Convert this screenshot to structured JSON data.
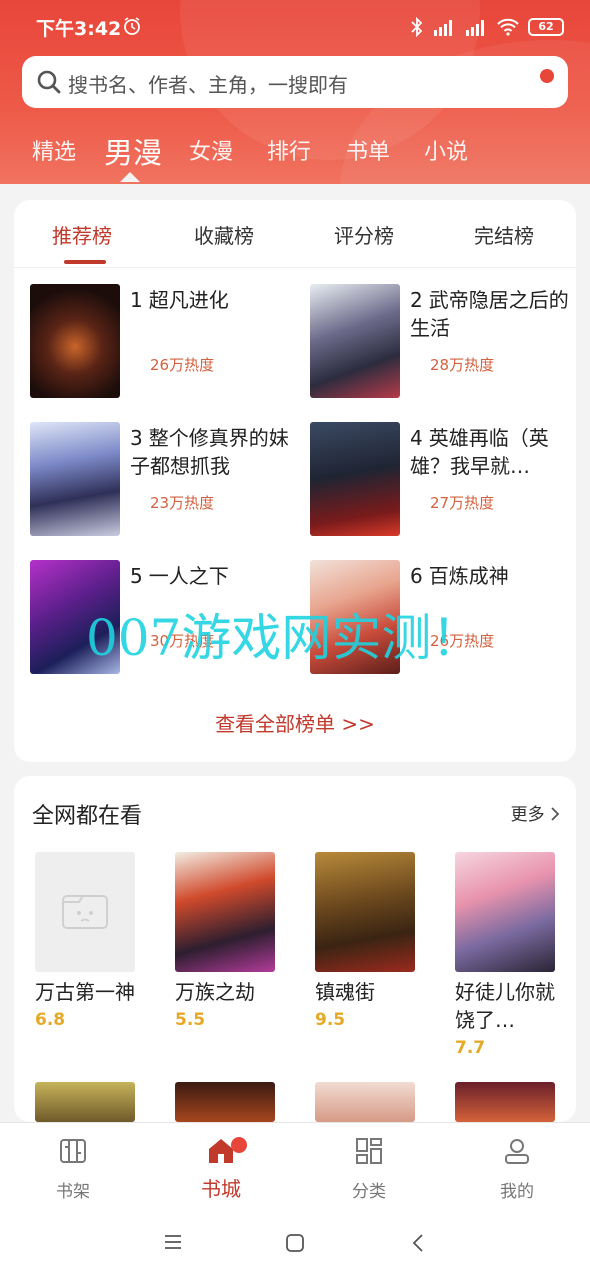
{
  "status_bar": {
    "time": "下午3:42",
    "battery": "62"
  },
  "search": {
    "placeholder": "搜书名、作者、主角，一搜即有"
  },
  "top_tabs": [
    "精选",
    "男漫",
    "女漫",
    "排行",
    "书单",
    "小说"
  ],
  "rank_tabs": [
    "推荐榜",
    "收藏榜",
    "评分榜",
    "完结榜"
  ],
  "rank_items": [
    {
      "num": "1",
      "title": "超凡进化",
      "heat": "26万热度"
    },
    {
      "num": "2",
      "title": "武帝隐居之后的生活",
      "heat": "28万热度"
    },
    {
      "num": "3",
      "title": "整个修真界的妹子都想抓我",
      "heat": "23万热度"
    },
    {
      "num": "4",
      "title": "英雄再临（英雄？我早就…",
      "heat": "27万热度"
    },
    {
      "num": "5",
      "title": "一人之下",
      "heat": "30万热度"
    },
    {
      "num": "6",
      "title": "百炼成神",
      "heat": "26万热度"
    }
  ],
  "view_all": "查看全部榜单 >>",
  "watermark": "007游戏网实测！",
  "hot_section": {
    "title": "全网都在看",
    "more": "更多",
    "items": [
      {
        "name": "万古第一神",
        "score": "6.8"
      },
      {
        "name": "万族之劫",
        "score": "5.5"
      },
      {
        "name": "镇魂街",
        "score": "9.5"
      },
      {
        "name": "好徒儿你就饶了…",
        "score": "7.7"
      }
    ]
  },
  "bottom_nav": [
    "书架",
    "书城",
    "分类",
    "我的"
  ],
  "colors": {
    "brand": "#e8463a",
    "accent": "#c0392b",
    "score": "#e6a927"
  }
}
